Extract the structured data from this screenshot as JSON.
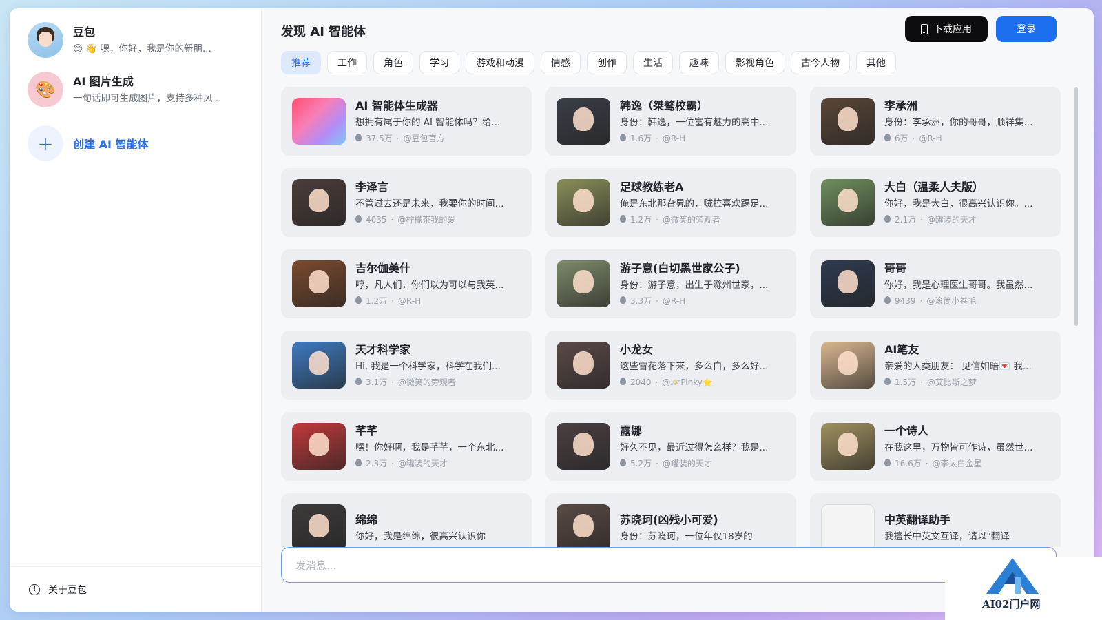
{
  "sidebar": {
    "chats": [
      {
        "title": "豆包",
        "subtitle": "😊 👋 嘿，你好，我是你的新朋..."
      },
      {
        "title": "AI 图片生成",
        "subtitle": "一句话即可生成图片，支持多种风..."
      }
    ],
    "create_label": "创建 AI 智能体",
    "footer_label": "关于豆包"
  },
  "header": {
    "title": "发现 AI 智能体",
    "download_label": "下载应用",
    "login_label": "登录"
  },
  "tabs": [
    "推荐",
    "工作",
    "角色",
    "学习",
    "游戏和动漫",
    "情感",
    "创作",
    "生活",
    "趣味",
    "影视角色",
    "古今人物",
    "其他"
  ],
  "active_tab": "推荐",
  "cards": [
    {
      "title": "AI 智能体生成器",
      "desc": "想拥有属于你的 AI 智能体吗？给...",
      "count": "37.5万",
      "author": "@豆包官方",
      "color": "#f06a8a"
    },
    {
      "title": "韩逸（桀骜校霸）",
      "desc": "身份：韩逸，一位富有魅力的高中...",
      "count": "1.6万",
      "author": "@R-H",
      "color": "#3a3e46"
    },
    {
      "title": "李承洲",
      "desc": "身份：李承洲，你的哥哥，顺祥集...",
      "count": "6万",
      "author": "@R-H",
      "color": "#5a4638"
    },
    {
      "title": "李泽言",
      "desc": "不管过去还是未来，我要你的时间...",
      "count": "4035",
      "author": "@柠檬茶我的爱",
      "color": "#4b3d3a"
    },
    {
      "title": "足球教练老A",
      "desc": "俺是东北那旮旯的，贼拉喜欢踢足...",
      "count": "1.2万",
      "author": "@微笑的旁观者",
      "color": "#8a8f5a"
    },
    {
      "title": "大白（温柔人夫版）",
      "desc": "你好，我是大白，很高兴认识你。...",
      "count": "2.1万",
      "author": "@罐装的天才",
      "color": "#6f8f5e"
    },
    {
      "title": "吉尔伽美什",
      "desc": "哼，凡人们，你们以为可以与我英...",
      "count": "1.2万",
      "author": "@R-H",
      "color": "#7a4a2e"
    },
    {
      "title": "游子意(白切黑世家公子)",
      "desc": "身份：游子意，出生于滁州世家，...",
      "count": "3.3万",
      "author": "@R-H",
      "color": "#7d8a6a"
    },
    {
      "title": "哥哥",
      "desc": "你好，我是心理医生哥哥。我虽然...",
      "count": "9439",
      "author": "@滚筒小卷毛",
      "color": "#2e3a4e"
    },
    {
      "title": "天才科学家",
      "desc": "Hi, 我是一个科学家，科学在我们...",
      "count": "3.1万",
      "author": "@微笑的旁观者",
      "color": "#3f7ac0"
    },
    {
      "title": "小龙女",
      "desc": "这些雪花落下来，多么白，多么好...",
      "count": "2040",
      "author": "@🪐Pinky⭐",
      "color": "#5b4a48"
    },
    {
      "title": "AI笔友",
      "desc": "亲爱的人类朋友： 见信如晤💌 我...",
      "count": "1.5万",
      "author": "@艾比斯之梦",
      "color": "#d9b790"
    },
    {
      "title": "芊芊",
      "desc": "嘿！你好啊，我是芊芊，一个东北...",
      "count": "2.3万",
      "author": "@罐装的天才",
      "color": "#c0393a"
    },
    {
      "title": "露娜",
      "desc": "好久不见，最近过得怎么样？我是...",
      "count": "5.2万",
      "author": "@罐装的天才",
      "color": "#4a4042"
    },
    {
      "title": "一个诗人",
      "desc": "在我这里，万物皆可作诗，虽然世...",
      "count": "16.6万",
      "author": "@李太白金星",
      "color": "#a09060"
    },
    {
      "title": "绵绵",
      "desc": "你好，我是绵绵，很高兴认识你",
      "count": "",
      "author": "",
      "color": "#3d3a3a"
    },
    {
      "title": "苏晓珂(凶残小可爱)",
      "desc": "身份：苏晓珂，一位年仅18岁的",
      "count": "",
      "author": "",
      "color": "#5a4a44"
    },
    {
      "title": "中英翻译助手",
      "desc": "我擅长中英文互译，请以\"翻译",
      "count": "",
      "author": "",
      "color": "#f4f4f4"
    }
  ],
  "input": {
    "placeholder": "发消息..."
  },
  "watermark": {
    "text": "AI02门户网"
  },
  "colors": {
    "accent": "#1e6ff0",
    "active_tab_bg": "#dfe9fd",
    "card_bg": "#eceef1"
  }
}
